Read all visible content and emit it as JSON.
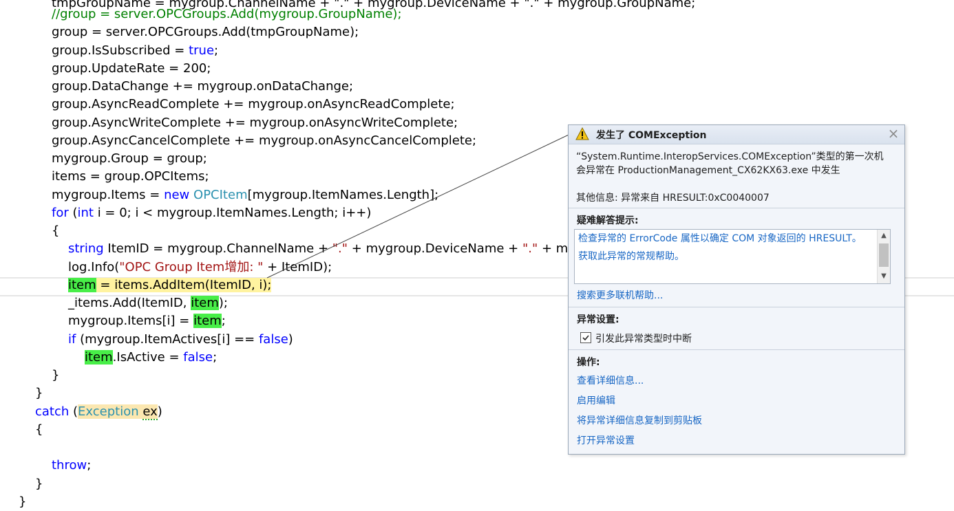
{
  "code": {
    "lines": [
      "tmpGroupName = mygroup.ChannelName + \".\" + mygroup.DeviceName + \".\" + mygroup.GroupName;",
      "//group = server.OPCGroups.Add(mygroup.GroupName);",
      "group = server.OPCGroups.Add(tmpGroupName);",
      "group.IsSubscribed = ",
      "true",
      ";",
      "group.UpdateRate = 200;",
      "group.DataChange += mygroup.onDataChange;",
      "group.AsyncReadComplete += mygroup.onAsyncReadComplete;",
      "group.AsyncWriteComplete += mygroup.onAsyncWriteComplete;",
      "group.AsyncCancelComplete += mygroup.onAsyncCancelComplete;",
      "mygroup.Group = group;",
      "items = group.OPCItems;",
      "mygroup.Items = ",
      "new",
      "OPCItem",
      "[mygroup.ItemNames.Length];",
      "for",
      "int",
      " i = 0; i < mygroup.ItemNames.Length; i++)",
      "{",
      "string",
      " ItemID = mygroup.ChannelName + ",
      "\".\"",
      " + mygroup.DeviceName + ",
      " + my",
      "log.Info(",
      "\"OPC Group Item增加: \"",
      " + ItemID);",
      "item",
      " = items.AddItem(ItemID, i);",
      "_items.Add(ItemID, ",
      ");",
      "mygroup.Items[i] = ",
      "if",
      " (mygroup.ItemActives[i] == ",
      "false",
      ")",
      ".IsActive = ",
      "}",
      "catch",
      "Exception",
      "ex",
      "throw",
      "(",
      " (",
      " ",
      "}"
    ]
  },
  "popup": {
    "title": "发生了 COMException",
    "close_glyph": "×",
    "description": "“System.Runtime.InteropServices.COMException”类型的第一次机会异常在 ProductionManagement_CX62KX63.exe 中发生",
    "extra_info": "其他信息: 异常来自 HRESULT:0xC0040007",
    "hints_title": "疑难解答提示:",
    "hints": [
      "检查异常的 ErrorCode 属性以确定 COM 对象返回的 HRESULT。",
      "获取此异常的常规帮助。"
    ],
    "search_more": "搜索更多联机帮助...",
    "exception_settings_title": "异常设置:",
    "break_checkbox_label": "引发此异常类型时中断",
    "break_checked": true,
    "actions_title": "操作:",
    "actions": [
      "查看详细信息...",
      "启用编辑",
      "将异常详细信息复制到剪贴板",
      "打开异常设置"
    ],
    "icon": "warning-icon"
  },
  "colors": {
    "keyword": "#0000ff",
    "type": "#2b91af",
    "string": "#a31515",
    "comment": "#008000",
    "highlight": "#48ee48",
    "link": "#1766c4"
  }
}
